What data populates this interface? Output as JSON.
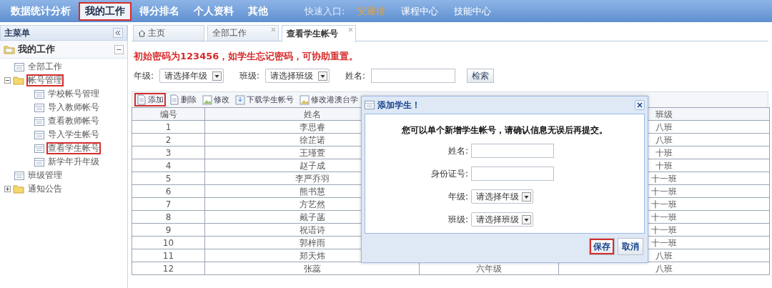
{
  "nav": {
    "items": [
      {
        "label": "数据统计分析",
        "selected": false,
        "highlighted": false
      },
      {
        "label": "我的工作",
        "selected": true,
        "highlighted": true
      },
      {
        "label": "得分排名",
        "selected": false,
        "highlighted": false
      },
      {
        "label": "个人资料",
        "selected": false,
        "highlighted": false
      },
      {
        "label": "其他",
        "selected": false,
        "highlighted": false
      }
    ],
    "quick_label": "快速入口:",
    "quick_links": [
      {
        "label": "安通排",
        "color": "#e8a33c"
      },
      {
        "label": "课程中心",
        "color": "#ffffff"
      },
      {
        "label": "技能中心",
        "color": "#ffffff"
      }
    ]
  },
  "sidebar": {
    "title": "主菜单",
    "panel_title": "我的工作",
    "items": [
      {
        "label": "全部工作",
        "highlighted": false
      },
      {
        "label": "帐号管理",
        "highlighted": true,
        "expanded": true,
        "children": [
          {
            "label": "学校帐号管理",
            "highlighted": false
          },
          {
            "label": "导入教师帐号",
            "highlighted": false
          },
          {
            "label": "查看教师帐号",
            "highlighted": false
          },
          {
            "label": "导入学生帐号",
            "highlighted": false
          },
          {
            "label": "查看学生帐号",
            "highlighted": true
          },
          {
            "label": "新学年升年级",
            "highlighted": false
          }
        ]
      },
      {
        "label": "班级管理",
        "highlighted": false
      },
      {
        "label": "通知公告",
        "highlighted": false,
        "expanded": false
      }
    ]
  },
  "tabs": [
    {
      "label": "主页",
      "kind": "home",
      "selected": false
    },
    {
      "label": "全部工作",
      "kind": "closable",
      "selected": false
    },
    {
      "label": "查看学生帐号",
      "kind": "closable",
      "selected": true
    }
  ],
  "notice": "初始密码为123456，如学生忘记密码，可协助重置。",
  "filters": [
    {
      "label": "年级:",
      "kind": "select",
      "placeholder": "请选择年级"
    },
    {
      "label": "班级:",
      "kind": "select",
      "placeholder": "请选择班级"
    },
    {
      "label": "姓名:",
      "kind": "input"
    }
  ],
  "search_button": "检索",
  "toolbar": [
    {
      "label": "添加",
      "highlighted": true
    },
    {
      "label": "删除",
      "highlighted": false
    },
    {
      "label": "修改",
      "highlighted": false
    },
    {
      "label": "下载学生帐号",
      "highlighted": false
    },
    {
      "label": "修改港澳台学",
      "highlighted": false
    }
  ],
  "table": {
    "columns": [
      "编号",
      "姓名",
      "班级"
    ],
    "rows": [
      {
        "id": "1",
        "name": "李思睿",
        "class": "八班"
      },
      {
        "id": "2",
        "name": "徐芷诺",
        "class": "八班"
      },
      {
        "id": "3",
        "name": "王瑾萱",
        "class": "十班"
      },
      {
        "id": "4",
        "name": "赵子成",
        "class": "十班"
      },
      {
        "id": "5",
        "name": "李严乔羽",
        "class": "十一班"
      },
      {
        "id": "6",
        "name": "熊书慧",
        "class": "十一班"
      },
      {
        "id": "7",
        "name": "方艺然",
        "class": "十一班"
      },
      {
        "id": "8",
        "name": "戴子菡",
        "class": "十一班"
      },
      {
        "id": "9",
        "name": "祝语诗",
        "class": "十一班"
      },
      {
        "id": "10",
        "name": "郭梓雨",
        "class": "十一班"
      },
      {
        "id": "11",
        "name": "郑天炜",
        "class": "八班"
      },
      {
        "id": "12",
        "name": "张蕊",
        "column_3": "六年级",
        "class": "八班"
      }
    ]
  },
  "dialog": {
    "title": "添加学生！",
    "intro": "您可以单个新增学生帐号，请确认信息无误后再提交。",
    "fields": [
      {
        "label": "姓名:",
        "kind": "input"
      },
      {
        "label": "身份证号:",
        "kind": "input"
      },
      {
        "label": "年级:",
        "kind": "select",
        "placeholder": "请选择年级"
      },
      {
        "label": "班级:",
        "kind": "select",
        "placeholder": "请选择班级"
      }
    ],
    "buttons": [
      {
        "label": "保存",
        "highlighted": true
      },
      {
        "label": "取消",
        "highlighted": false
      }
    ]
  }
}
